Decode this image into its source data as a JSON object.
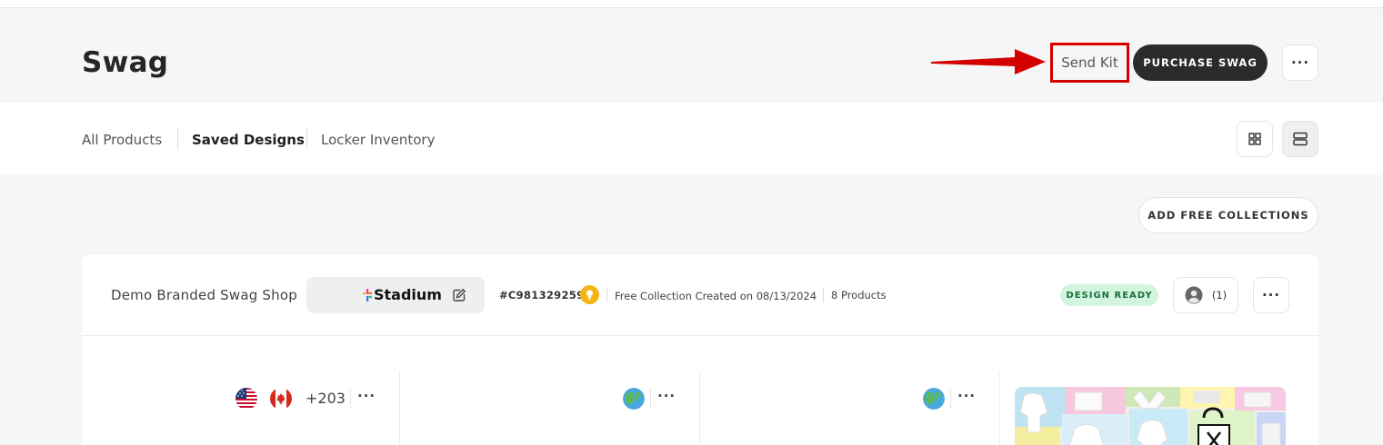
{
  "page": {
    "title": "Swag",
    "send_kit_label": "Send Kit",
    "purchase_label": "PURCHASE SWAG",
    "more_label": "···"
  },
  "tabs": [
    {
      "label": "All Products",
      "active": false
    },
    {
      "label": "Saved Designs",
      "active": true
    },
    {
      "label": "Locker Inventory",
      "active": false
    }
  ],
  "view_toggle": {
    "grid_icon": "grid-icon",
    "list_icon": "list-icon",
    "selected": "list"
  },
  "add_free_label": "ADD FREE COLLECTIONS",
  "collection": {
    "name": "Demo Branded Swag Shop",
    "brand": "Stadium",
    "id": "#C981329259",
    "created": "Free Collection Created on 08/13/2024",
    "products": "8 Products",
    "status": "DESIGN READY",
    "members_count": "(1)",
    "more_label": "···"
  },
  "product_columns": [
    {
      "flags": [
        "us-flag-icon",
        "canada-flag-icon"
      ],
      "extra_count": "+203",
      "more_label": "···"
    },
    {
      "flags": [
        "globe-icon"
      ],
      "more_label": "···"
    },
    {
      "flags": [
        "globe-icon"
      ],
      "more_label": "···"
    }
  ],
  "colors": {
    "annotation_red": "#d40000",
    "primary_dark": "#2b2b2b",
    "badge_green_bg": "#d3f5df",
    "badge_green_text": "#1b6e3b",
    "coin_gold": "#f4b514"
  }
}
